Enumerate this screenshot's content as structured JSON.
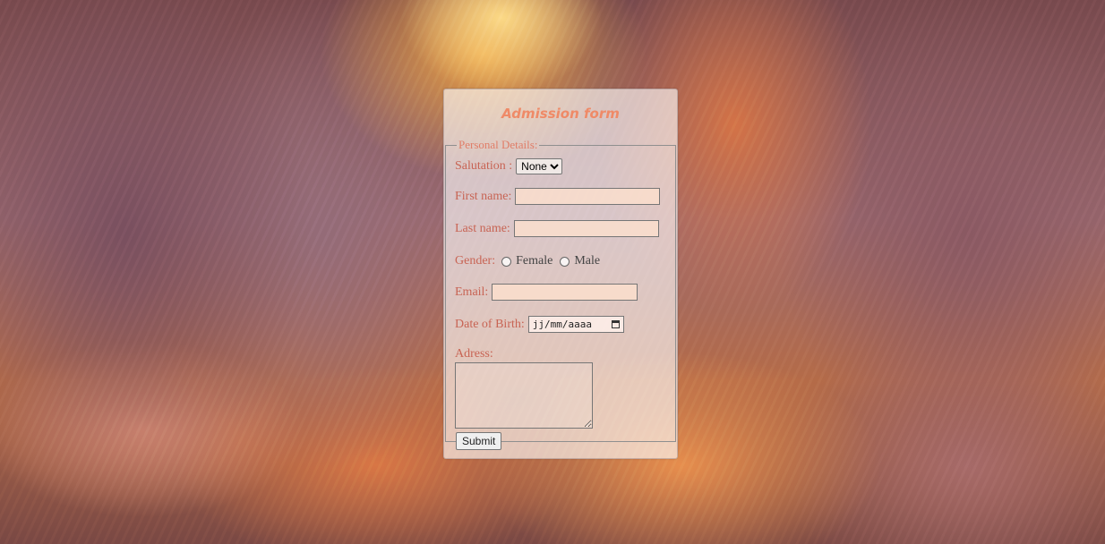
{
  "form": {
    "title": "Admission form",
    "legend": "Personal Details:",
    "salutation": {
      "label": "Salutation :",
      "selected": "None"
    },
    "first_name": {
      "label": "First name:",
      "value": ""
    },
    "last_name": {
      "label": "Last name:",
      "value": ""
    },
    "gender": {
      "label": "Gender:",
      "options": [
        "Female",
        "Male"
      ]
    },
    "email": {
      "label": "Email:",
      "value": ""
    },
    "dob": {
      "label": "Date of Birth:",
      "placeholder": "jj/mm/aaaa"
    },
    "address": {
      "label": "Adress:",
      "value": ""
    },
    "submit_label": "Submit"
  },
  "colors": {
    "title": "#ef8a67",
    "label": "#c86454",
    "legend": "#e07d67"
  }
}
